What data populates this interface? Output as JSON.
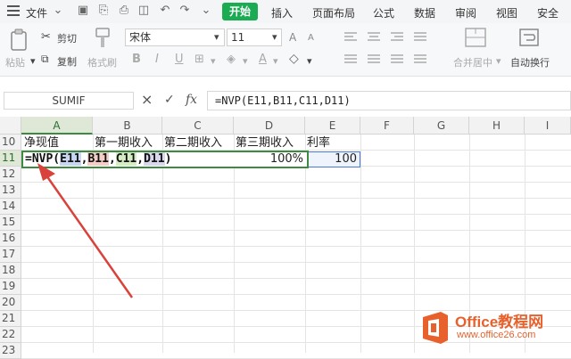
{
  "menu": {
    "file": "文件",
    "start": "开始",
    "tabs": [
      "插入",
      "页面布局",
      "公式",
      "数据",
      "审阅",
      "视图",
      "安全"
    ]
  },
  "ribbon": {
    "paste": "粘贴",
    "cut": "剪切",
    "copy": "复制",
    "format_painter": "格式刷",
    "font_name": "宋体",
    "font_size": "11",
    "merge_center": "合并居中",
    "wrap_text": "自动换行",
    "bold": "B",
    "italic": "I",
    "underline": "U",
    "font_color_a": "A",
    "font_grow": "A",
    "font_shrink": "A"
  },
  "formula_bar": {
    "name_box": "SUMIF",
    "fx": "fx",
    "cancel": "×",
    "confirm": "✓",
    "formula": "=NVP(E11,B11,C11,D11)"
  },
  "columns": [
    "A",
    "B",
    "C",
    "D",
    "E",
    "F",
    "G",
    "H",
    "I"
  ],
  "rows": [
    "10",
    "11",
    "12",
    "13",
    "14",
    "15",
    "16",
    "17",
    "18",
    "19",
    "20",
    "21",
    "22",
    "23"
  ],
  "cells": {
    "A10": "净现值",
    "B10": "第一期收入",
    "C10": "第二期收入",
    "D10": "第三期收入",
    "E10": "利率",
    "A11_prefix": "=NVP(",
    "A11_e": "E11",
    "A11_c1": ",",
    "A11_b": "B11",
    "A11_c2": ",",
    "A11_c": "C11",
    "A11_c3": ",",
    "A11_d": "D11",
    "A11_suffix": ")",
    "D11": "100%",
    "E11": "100"
  },
  "colors": {
    "accent": "#1aab53",
    "arrow": "#d9423a",
    "ref_e": "#c9d6f2",
    "ref_b": "#f4cfc8",
    "ref_c": "#d6ecc4",
    "ref_d": "#d9d6ee"
  },
  "watermark": {
    "title": "Office教程网",
    "url": "www.office26.com"
  }
}
